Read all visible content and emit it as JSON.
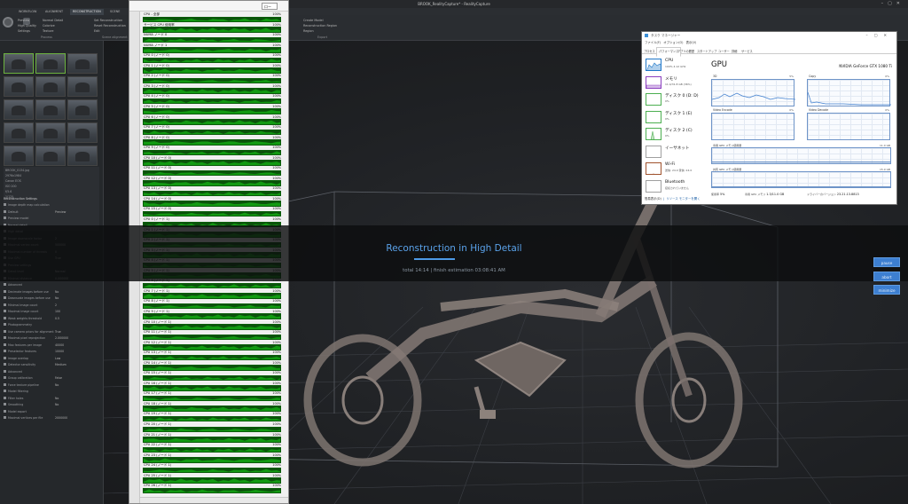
{
  "window": {
    "title": "BROOK_RealityCapture* - RealityCapture"
  },
  "ribbon": {
    "tabs": [
      "WORKFLOW",
      "ALIGNMENT",
      "RECONSTRUCTION",
      "SCENE"
    ],
    "active_tab": "RECONSTRUCTION",
    "items": [
      [
        "Preview",
        "High Quality",
        "Settings"
      ],
      [
        "Normal Detail",
        "Colorize",
        "Texture"
      ],
      [
        "Set Reconstruction",
        "Reset Reconstruction",
        "Edit"
      ],
      [
        "Filter Selection",
        "Mesh Decimation",
        "Smooth"
      ],
      [
        "Simplify",
        "Close Holes",
        "Models"
      ],
      [
        "Create Model",
        "Reconstruction Region",
        "Region"
      ]
    ],
    "group_labels": [
      "Process",
      "Scene alignment",
      "Mesh",
      "Export"
    ]
  },
  "left_panel": {
    "info_lines": [
      "BROOK_0134.jpg",
      "2976x1984",
      "Canon EOS",
      "ISO 200",
      "f/5.6",
      "1/125"
    ],
    "settings_header": "Reconstruction Settings",
    "rows": [
      [
        "Image depth map calculation",
        ""
      ],
      [
        "Default",
        "Preview"
      ],
      [
        "Preview model",
        ""
      ],
      [
        "Normal detail",
        ""
      ],
      [
        "High detail",
        ""
      ],
      [
        "Image downscale factor",
        "2"
      ],
      [
        "Maximal vertex count",
        "500000"
      ],
      [
        "Maximal number of threads",
        "0"
      ],
      [
        "Use GPU",
        "True"
      ],
      [
        "Preview settings",
        ""
      ],
      [
        "Detail level",
        "Normal"
      ],
      [
        "Minimal distance",
        "0.000000"
      ],
      [
        "Advanced",
        ""
      ],
      [
        "Decimate images before use",
        "No"
      ],
      [
        "Downscale images before use",
        "No"
      ],
      [
        "Minimal image count",
        "2"
      ],
      [
        "Maximal image count",
        "100"
      ],
      [
        "Weak weights threshold",
        "0.5"
      ],
      [
        "Photogrammetry",
        ""
      ],
      [
        "Use camera priors for alignment",
        "True"
      ],
      [
        "Maximal pixel reprojection",
        "2.000000"
      ],
      [
        "Max features per image",
        "40000"
      ],
      [
        "Preselector features",
        "10000"
      ],
      [
        "Image overlap",
        "Low"
      ],
      [
        "Detector sensitivity",
        "Medium"
      ],
      [
        "Advanced",
        ""
      ],
      [
        "Group calibration",
        "False"
      ],
      [
        "Force texture pipeline",
        "No"
      ],
      [
        "Model filtering",
        ""
      ],
      [
        "Filter holes",
        "No"
      ],
      [
        "Smoothing",
        "No"
      ],
      [
        "Model export",
        ""
      ],
      [
        "Maximal vertices per file",
        "2000000"
      ]
    ]
  },
  "perfmon": {
    "dropdown": "ロー",
    "rows": [
      {
        "label": "CPU - 全部",
        "pct": "100%"
      },
      {
        "label": "サービス CPU 使用率",
        "pct": "100%"
      },
      {
        "label": "NUMA ノード 0",
        "pct": "100%"
      },
      {
        "label": "NUMA ノード 1",
        "pct": "100%"
      },
      {
        "label": "CPU 0 (ノード 0)",
        "pct": "100%"
      },
      {
        "label": "CPU 1 (ノード 0)",
        "pct": "100%"
      },
      {
        "label": "CPU 2 (ノード 0)",
        "pct": "100%"
      },
      {
        "label": "CPU 3 (ノード 0)",
        "pct": "100%"
      },
      {
        "label": "CPU 4 (ノード 0)",
        "pct": "100%"
      },
      {
        "label": "CPU 5 (ノード 0)",
        "pct": "100%"
      },
      {
        "label": "CPU 6 (ノード 0)",
        "pct": "100%"
      },
      {
        "label": "CPU 7 (ノード 0)",
        "pct": "100%"
      },
      {
        "label": "CPU 8 (ノード 0)",
        "pct": "100%"
      },
      {
        "label": "CPU 9 (ノード 0)",
        "pct": "100%"
      },
      {
        "label": "CPU 10 (ノード 0)",
        "pct": "100%"
      },
      {
        "label": "CPU 11 (ノード 0)",
        "pct": "100%"
      },
      {
        "label": "CPU 12 (ノード 0)",
        "pct": "100%"
      },
      {
        "label": "CPU 13 (ノード 0)",
        "pct": "100%"
      },
      {
        "label": "CPU 14 (ノード 0)",
        "pct": "100%"
      },
      {
        "label": "CPU 15 (ノード 0)",
        "pct": "100%"
      },
      {
        "label": "CPU 0 (ノード 1)",
        "pct": "100%"
      },
      {
        "label": "CPU 1 (ノード 1)",
        "pct": "100%"
      },
      {
        "label": "CPU 2 (ノード 1)",
        "pct": "100%"
      },
      {
        "label": "CPU 3 (ノード 1)",
        "pct": "100%"
      },
      {
        "label": "CPU 4 (ノード 1)",
        "pct": "100%"
      },
      {
        "label": "CPU 5 (ノード 1)",
        "pct": "100%"
      },
      {
        "label": "CPU 6 (ノード 1)",
        "pct": "100%"
      },
      {
        "label": "CPU 7 (ノード 1)",
        "pct": "100%"
      },
      {
        "label": "CPU 8 (ノード 1)",
        "pct": "100%"
      },
      {
        "label": "CPU 9 (ノード 1)",
        "pct": "100%"
      },
      {
        "label": "CPU 10 (ノード 1)",
        "pct": "100%"
      },
      {
        "label": "CPU 11 (ノード 1)",
        "pct": "100%"
      },
      {
        "label": "CPU 12 (ノード 1)",
        "pct": "100%"
      },
      {
        "label": "CPU 13 (ノード 1)",
        "pct": "100%"
      },
      {
        "label": "CPU 14 (ノード 1)",
        "pct": "100%"
      },
      {
        "label": "CPU 15 (ノード 1)",
        "pct": "100%"
      },
      {
        "label": "CPU 16 (ノード 1)",
        "pct": "100%"
      },
      {
        "label": "CPU 17 (ノード 1)",
        "pct": "100%"
      },
      {
        "label": "CPU 18 (ノード 1)",
        "pct": "100%"
      },
      {
        "label": "CPU 19 (ノード 1)",
        "pct": "100%"
      },
      {
        "label": "CPU 20 (ノード 1)",
        "pct": "100%"
      },
      {
        "label": "CPU 21 (ノード 1)",
        "pct": "100%"
      },
      {
        "label": "CPU 22 (ノード 1)",
        "pct": "100%"
      },
      {
        "label": "CPU 23 (ノード 1)",
        "pct": "100%"
      },
      {
        "label": "CPU 24 (ノード 1)",
        "pct": "100%"
      },
      {
        "label": "CPU 25 (ノード 1)",
        "pct": "100%"
      },
      {
        "label": "CPU 26 (ノード 1)",
        "pct": "100%"
      }
    ]
  },
  "taskmgr": {
    "title": "タスク マネージャー",
    "menu": "ファイル(F)  オプション(O)  表示(V)",
    "tabs": [
      "プロセス",
      "パフォーマンス",
      "アプリの履歴",
      "スタートアップ",
      "ユーザー",
      "詳細",
      "サービス"
    ],
    "active_tab": "パフォーマンス",
    "devices": [
      {
        "name": "CPU",
        "sub": "100%  4.12 GHz",
        "icon": "cpu-graph"
      },
      {
        "name": "メモリ",
        "sub": "11.4/31.8 GB (36%)",
        "icon": "memory-graph"
      },
      {
        "name": "ディスク 0 (D: D)",
        "sub": "0%",
        "icon": "disk-graph"
      },
      {
        "name": "ディスク 1 (E)",
        "sub": "0%",
        "icon": "disk-graph"
      },
      {
        "name": "ディスク 2 (C)",
        "sub": "0%",
        "icon": "disk-graph"
      },
      {
        "name": "イーサネット",
        "sub": "",
        "icon": "ethernet-graph"
      },
      {
        "name": "Wi-Fi",
        "sub": "送信: 24.0  受信: 24.0",
        "icon": "wifi-graph"
      },
      {
        "name": "Bluetooth",
        "sub": "接続されていません",
        "icon": "bluetooth-graph"
      }
    ],
    "gpu_header": "GPU",
    "gpu_model": "NVIDIA GeForce GTX 1080 Ti",
    "engines": [
      {
        "label": "3D",
        "pct": "5%"
      },
      {
        "label": "Copy",
        "pct": "0%"
      },
      {
        "label": "Video Encode",
        "pct": "0%"
      },
      {
        "label": "Video Decode",
        "pct": "0%"
      }
    ],
    "mem_graphs": [
      {
        "label": "専用 GPU メモリ使用量",
        "max": "11.0 GB",
        "level": 0.12
      },
      {
        "label": "共有 GPU メモリ使用量",
        "max": "15.9 GB",
        "level": 0.05
      }
    ],
    "stats": [
      {
        "label": "使用率",
        "value": "5%"
      },
      {
        "label": "専用 GPU メモリ",
        "value": "1.3/11.0 GB"
      },
      {
        "label": "ドライバーのバージョン",
        "value": "23.21.13.8813"
      }
    ],
    "footer_simple": "簡易表示(D)",
    "footer_link": "リソース モニターを開く"
  },
  "banner": {
    "title": "Reconstruction in High Detail",
    "subtitle": "total 14:14 | finish estimation 03:08:41 AM",
    "progress": 1.0,
    "buttons": [
      "pause",
      "abort",
      "minimize"
    ]
  },
  "colors": {
    "accent": "#4d9ae6",
    "cpu_graph": "#129a12",
    "selection": "#6cb33f"
  }
}
